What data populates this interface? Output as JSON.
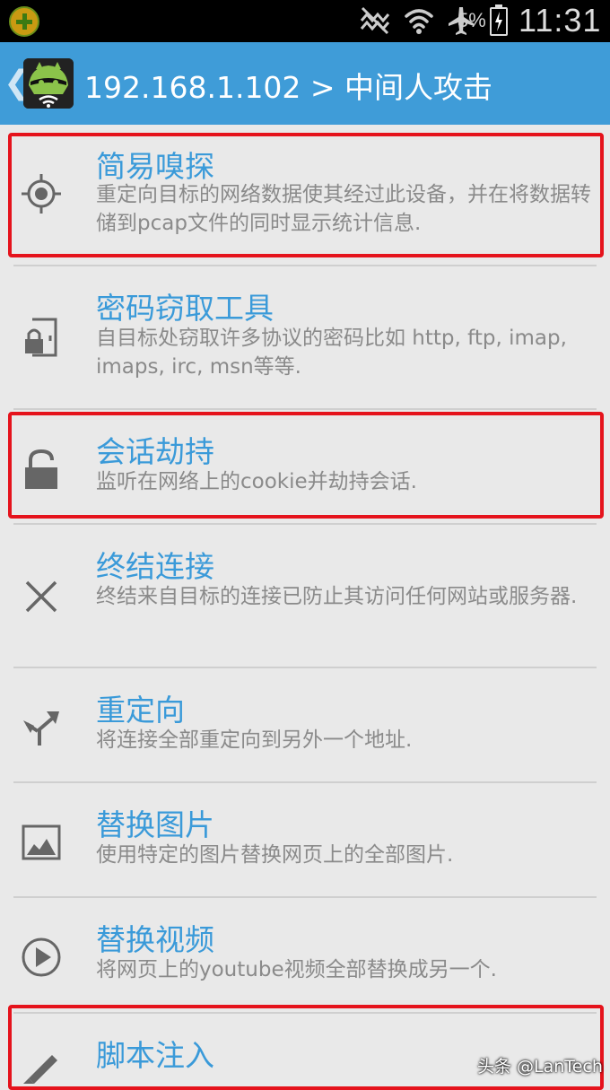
{
  "status_bar": {
    "battery_percent": "5%",
    "time": "11:31",
    "icons": [
      "app-notification-icon",
      "mute-icon",
      "wifi-icon",
      "airplane-mode-icon",
      "battery-charging-icon"
    ]
  },
  "action_bar": {
    "title": "192.168.1.102 > 中间人攻击",
    "back_glyph": "❮"
  },
  "items": [
    {
      "title": "简易嗅探",
      "desc": "重定向目标的网络数据使其经过此设备，并在将数据转储到pcap文件的同时显示统计信息.",
      "icon": "crosshair-icon"
    },
    {
      "title": "密码窃取工具",
      "desc": "自目标处窃取许多协议的密码比如 http, ftp, imap, imaps, irc, msn等等.",
      "icon": "door-lock-icon"
    },
    {
      "title": "会话劫持",
      "desc": "监听在网络上的cookie并劫持会话.",
      "icon": "padlock-open-icon"
    },
    {
      "title": "终结连接",
      "desc": "终结来自目标的连接已防止其访问任何网站或服务器.",
      "icon": "close-x-icon"
    },
    {
      "title": "重定向",
      "desc": "将连接全部重定向到另外一个地址.",
      "icon": "redirect-arrows-icon"
    },
    {
      "title": "替换图片",
      "desc": "使用特定的图片替换网页上的全部图片.",
      "icon": "image-icon"
    },
    {
      "title": "替换视频",
      "desc": "将网页上的youtube视频全部替换成另一个.",
      "icon": "play-icon"
    },
    {
      "title": "脚本注入",
      "desc": "",
      "icon": "pen-icon"
    }
  ],
  "watermark": "头条 @LanTech",
  "colors": {
    "action_bar": "#3f9cd8",
    "title_text": "#3a9ad9",
    "desc_text": "#8a8a8a",
    "highlight_box": "#e5131c",
    "background": "#e9e9e9"
  }
}
